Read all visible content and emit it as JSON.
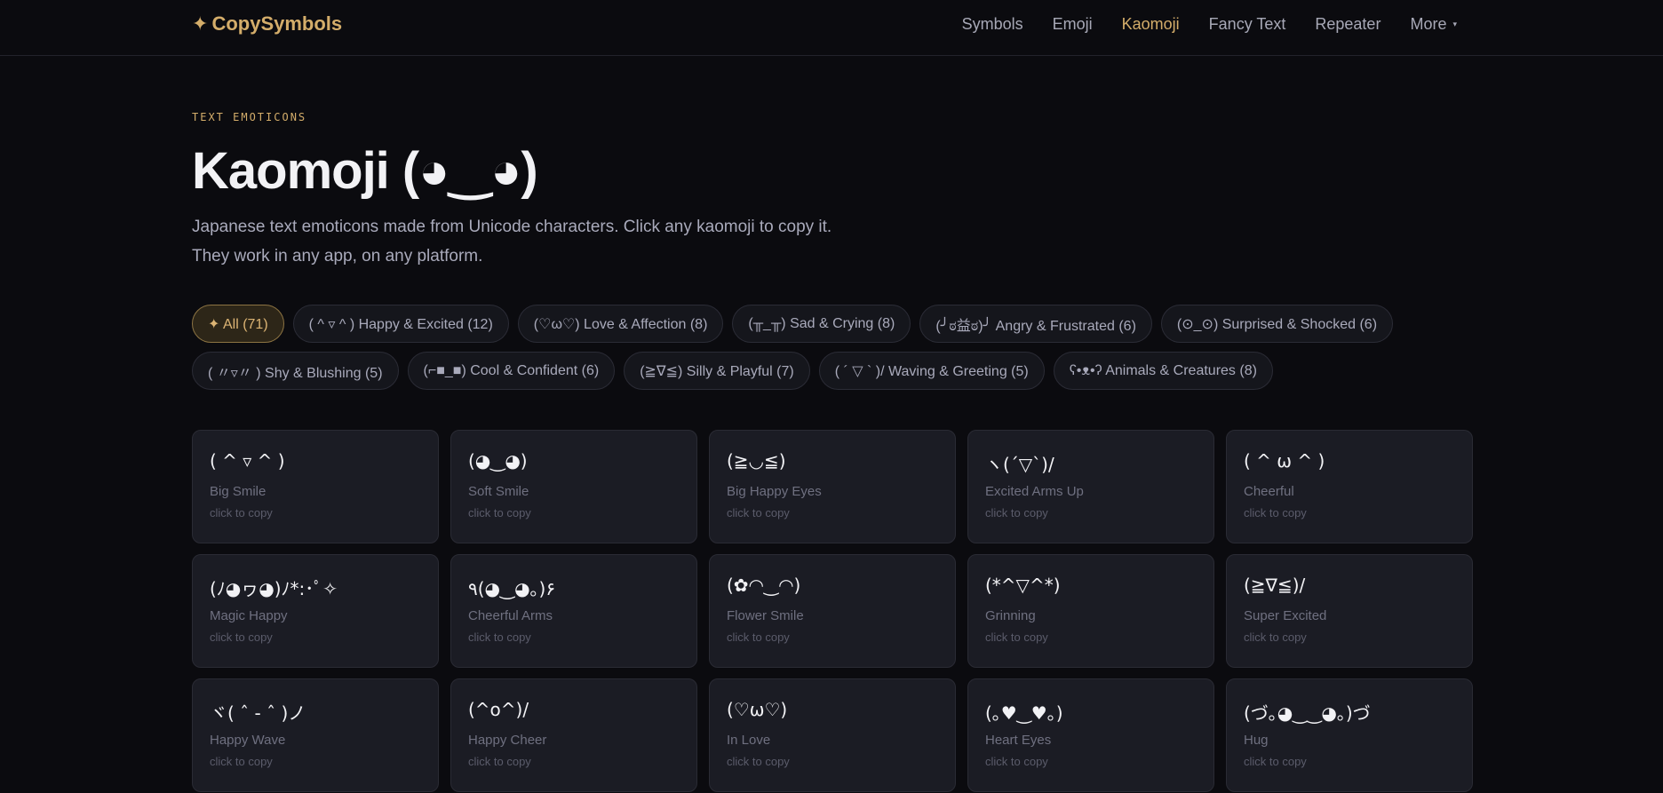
{
  "nav": {
    "brand": "CopySymbols",
    "brand_icon": "✦",
    "items": [
      {
        "label": "Symbols",
        "active": false
      },
      {
        "label": "Emoji",
        "active": false
      },
      {
        "label": "Kaomoji",
        "active": true
      },
      {
        "label": "Fancy Text",
        "active": false
      },
      {
        "label": "Repeater",
        "active": false
      },
      {
        "label": "More",
        "active": false
      }
    ],
    "more_caret": "▾"
  },
  "hero": {
    "eyebrow": "TEXT EMOTICONS",
    "title": "Kaomoji (◕‿◕)",
    "description": "Japanese text emoticons made from Unicode characters. Click any kaomoji to copy it. They work in any app, on any platform."
  },
  "filters": [
    "✦ All (71)",
    "( ^ ▿ ^ ) Happy & Excited (12)",
    "(♡ω♡) Love & Affection (8)",
    "(╥_╥) Sad & Crying (8)",
    "(╯ಠ益ಠ)╯ Angry & Frustrated (6)",
    "(⊙_⊙) Surprised & Shocked (6)",
    "( 〃▿〃 ) Shy & Blushing (5)",
    "(⌐■_■) Cool & Confident (6)",
    "(≧∇≦) Silly & Playful (7)",
    "( ´ ▽ ` )/ Waving & Greeting (5)",
    "ʕ•ᴥ•ʔ Animals & Creatures (8)"
  ],
  "active_filter_index": 0,
  "copy_hint": "click to copy",
  "kaomoji": [
    {
      "face": "( ^ ▿ ^ )",
      "name": "Big Smile"
    },
    {
      "face": "(◕‿◕)",
      "name": "Soft Smile"
    },
    {
      "face": "(≧◡≦)",
      "name": "Big Happy Eyes"
    },
    {
      "face": "ヽ(´▽`)/",
      "name": "Excited Arms Up"
    },
    {
      "face": "( ^ ω ^ )",
      "name": "Cheerful"
    },
    {
      "face": "(ﾉ◕ヮ◕)ﾉ*:･ﾟ✧",
      "name": "Magic Happy"
    },
    {
      "face": "٩(◕‿◕｡)۶",
      "name": "Cheerful Arms"
    },
    {
      "face": "(✿◠‿◠)",
      "name": "Flower Smile"
    },
    {
      "face": "(*^▽^*)",
      "name": "Grinning"
    },
    {
      "face": "(≧∇≦)/",
      "name": "Super Excited"
    },
    {
      "face": "ヾ( ˆ - ˆ )ノ",
      "name": "Happy Wave"
    },
    {
      "face": "(^o^)/",
      "name": "Happy Cheer"
    },
    {
      "face": "(♡ω♡)",
      "name": "In Love"
    },
    {
      "face": "(｡♥‿♥｡)",
      "name": "Heart Eyes"
    },
    {
      "face": "(づ｡◕‿‿◕｡)づ",
      "name": "Hug"
    }
  ]
}
